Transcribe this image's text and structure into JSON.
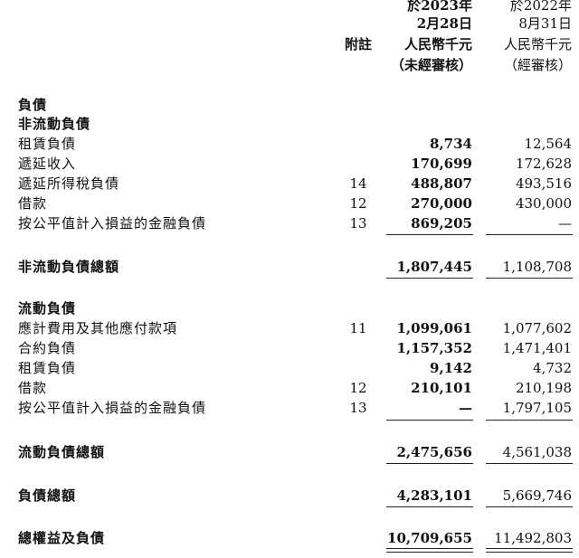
{
  "header": {
    "note_label": "附註",
    "col1": [
      "於2023年",
      "2月28日",
      "人民幣千元",
      "（未經審核）"
    ],
    "col2": [
      "於2022年",
      "8月31日",
      "人民幣千元",
      "（經審核）"
    ]
  },
  "sections": {
    "liabilities_title": "負債",
    "noncurrent_title": "非流動負債",
    "noncurrent_rows": [
      {
        "label": "租賃負債",
        "note": "",
        "v1": "8,734",
        "v2": "12,564"
      },
      {
        "label": "遞延收入",
        "note": "",
        "v1": "170,699",
        "v2": "172,628"
      },
      {
        "label": "遞延所得稅負債",
        "note": "14",
        "v1": "488,807",
        "v2": "493,516"
      },
      {
        "label": "借款",
        "note": "12",
        "v1": "270,000",
        "v2": "430,000"
      },
      {
        "label": "按公平值計入損益的金融負債",
        "note": "13",
        "v1": "869,205",
        "v2": "—"
      }
    ],
    "noncurrent_total": {
      "label": "非流動負債總額",
      "v1": "1,807,445",
      "v2": "1,108,708"
    },
    "current_title": "流動負債",
    "current_rows": [
      {
        "label": "應計費用及其他應付款項",
        "note": "11",
        "v1": "1,099,061",
        "v2": "1,077,602"
      },
      {
        "label": "合約負債",
        "note": "",
        "v1": "1,157,352",
        "v2": "1,471,401"
      },
      {
        "label": "租賃負債",
        "note": "",
        "v1": "9,142",
        "v2": "4,732"
      },
      {
        "label": "借款",
        "note": "12",
        "v1": "210,101",
        "v2": "210,198"
      },
      {
        "label": "按公平值計入損益的金融負債",
        "note": "13",
        "v1": "—",
        "v2": "1,797,105"
      }
    ],
    "current_total": {
      "label": "流動負債總額",
      "v1": "2,475,656",
      "v2": "4,561,038"
    },
    "total_liabilities": {
      "label": "負債總額",
      "v1": "4,283,101",
      "v2": "5,669,746"
    },
    "total_equity_liabilities": {
      "label": "總權益及負債",
      "v1": "10,709,655",
      "v2": "11,492,803"
    }
  }
}
